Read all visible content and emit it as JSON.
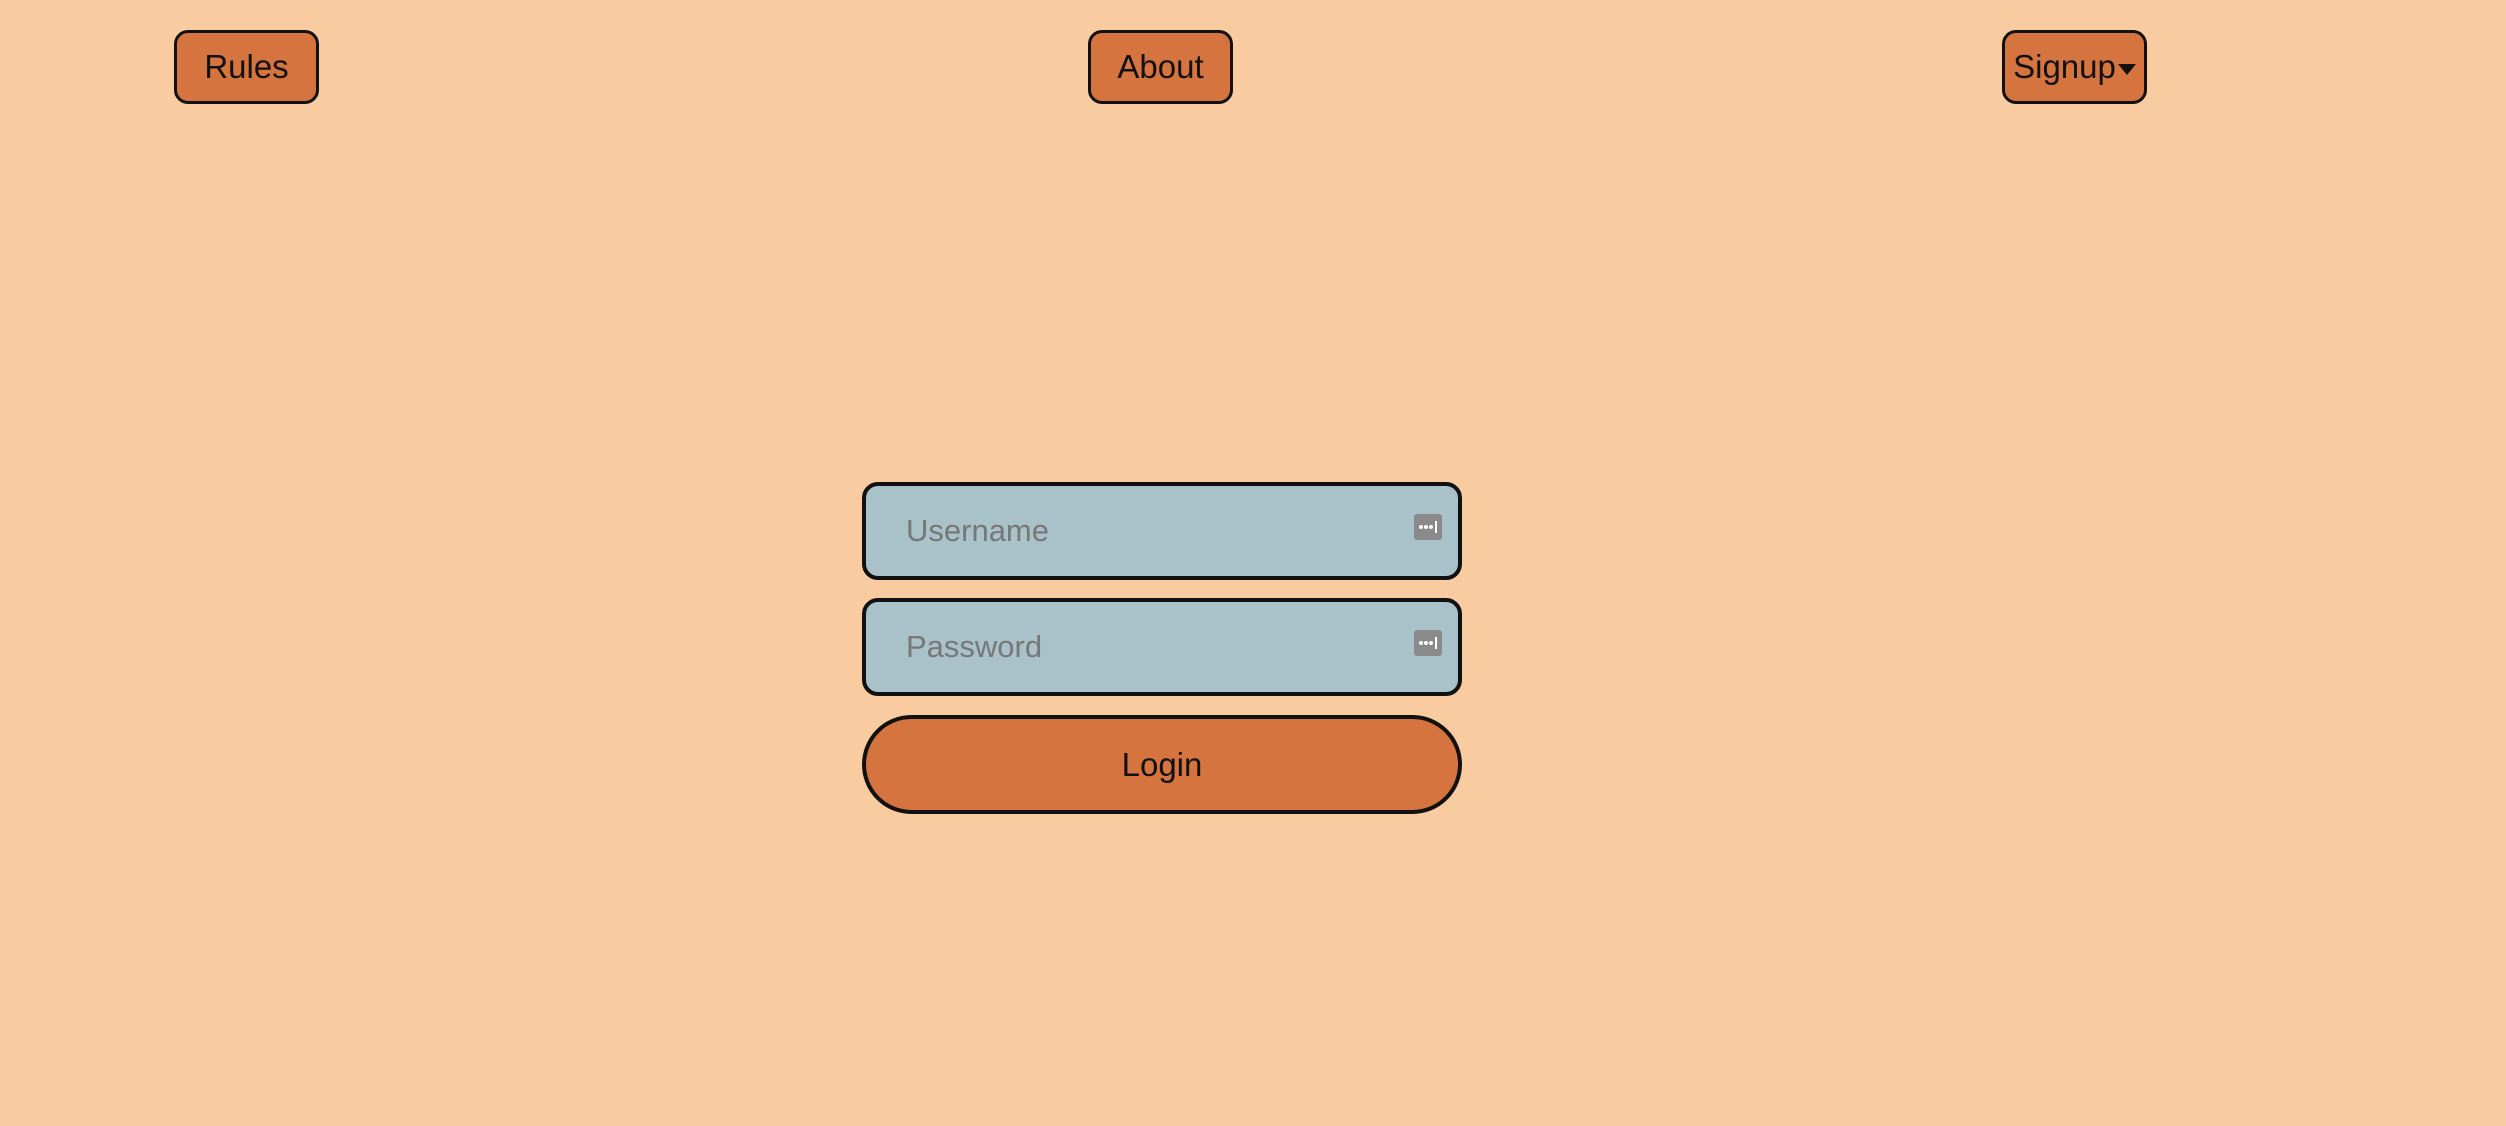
{
  "nav": {
    "rules_label": "Rules",
    "about_label": "About",
    "signup_label": "Signup"
  },
  "login_form": {
    "username_placeholder": "Username",
    "password_placeholder": "Password",
    "login_label": "Login"
  },
  "icons": {
    "signup_caret": "caret-down-icon",
    "field_autofill": "password-key-icon"
  },
  "colors": {
    "background": "#f8cca0",
    "button": "#d6743f",
    "input": "#a9c1c9",
    "border": "#111111",
    "placeholder": "#777777"
  }
}
